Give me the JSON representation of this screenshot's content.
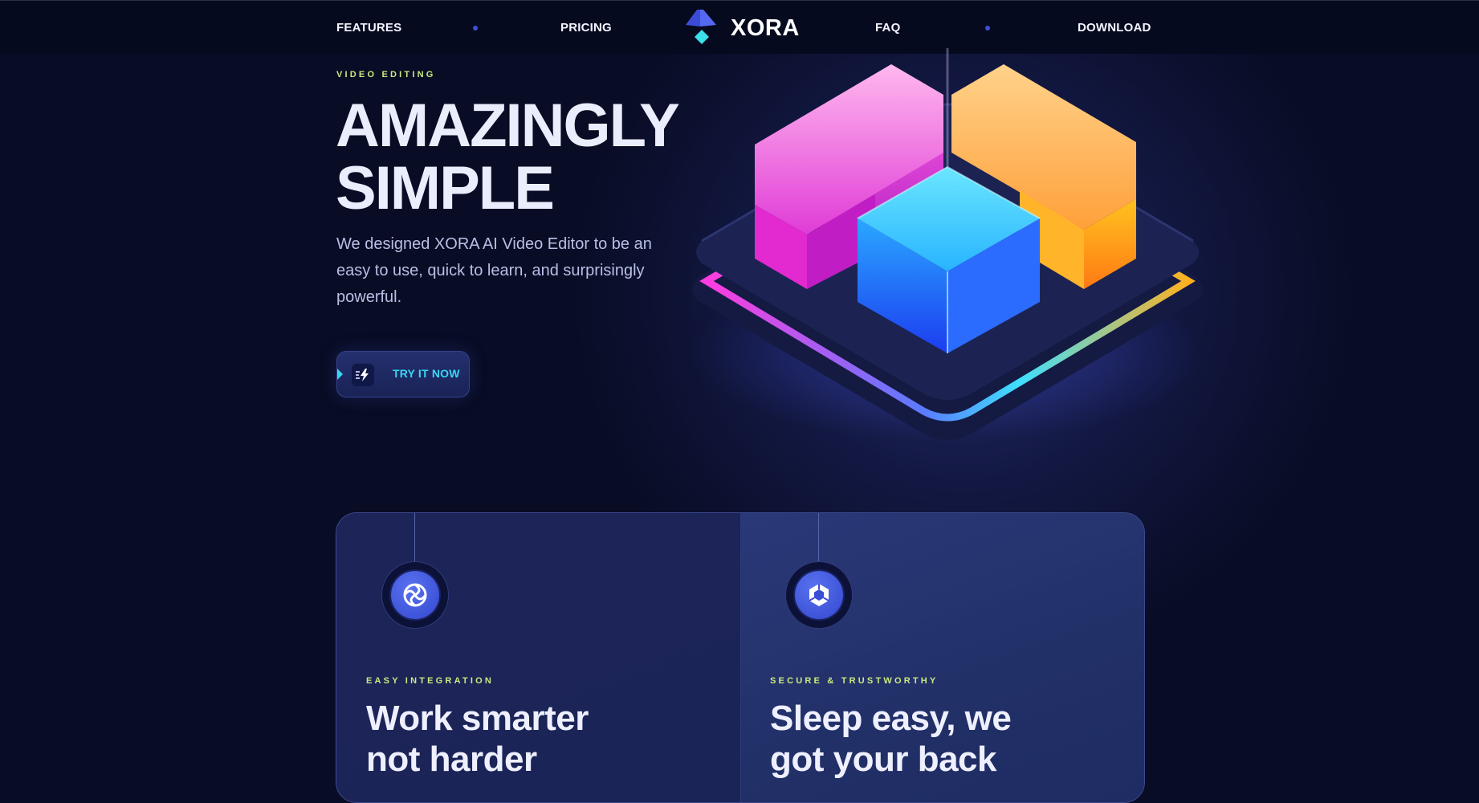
{
  "nav": {
    "links": [
      {
        "label": "FEATURES"
      },
      {
        "label": "PRICING"
      },
      {
        "label": "FAQ"
      },
      {
        "label": "DOWNLOAD"
      }
    ],
    "logo_text": "XORA"
  },
  "hero": {
    "eyebrow": "VIDEO EDITING",
    "title_line1": "AMAZINGLY",
    "title_line2": "SIMPLE",
    "description": "We designed XORA AI Video Editor to be an easy to use, quick to learn, and surprisingly powerful.",
    "cta_label": "TRY IT NOW",
    "cta_icon": "lightning-icon"
  },
  "cards": [
    {
      "icon": "swirl-icon",
      "eyebrow": "EASY INTEGRATION",
      "title_line1": "Work smarter",
      "title_line2": "not harder"
    },
    {
      "icon": "shield-hexagon-icon",
      "eyebrow": "SECURE & TRUSTWORTHY",
      "title_line1": "Sleep easy, we",
      "title_line2": "got your back"
    }
  ],
  "colors": {
    "background": "#080c24",
    "accent_lime": "#c8ea80",
    "accent_cyan": "#3ad6f5",
    "accent_blue": "#3d50d8"
  }
}
